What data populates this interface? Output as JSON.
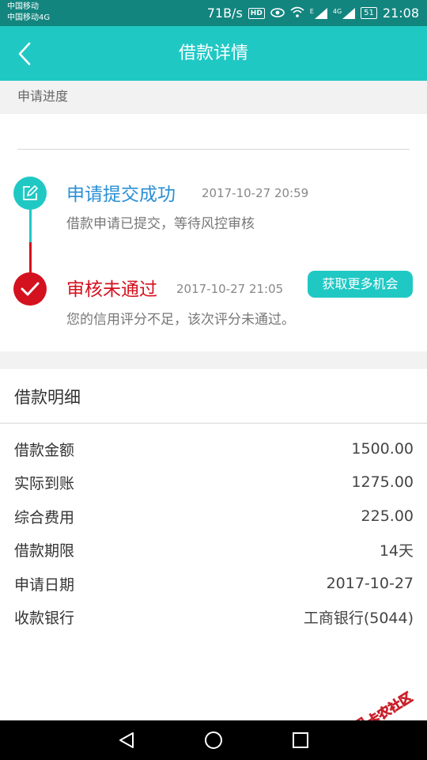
{
  "status_bar": {
    "carrier_1": "中国移动",
    "carrier_2": "中国移动4G",
    "speed": "71B/s",
    "hd": "HD",
    "signal_1_tag": "E",
    "signal_2_tag": "4G",
    "battery": "51",
    "time": "21:08"
  },
  "nav": {
    "title": "借款详情"
  },
  "progress": {
    "section_label": "申请进度",
    "steps": [
      {
        "title": "申请提交成功",
        "time": "2017-10-27 20:59",
        "desc": "借款申请已提交，等待风控审核"
      },
      {
        "title": "审核未通过",
        "time": "2017-10-27 21:05",
        "desc": "您的信用评分不足，该次评分未通过。",
        "action": "获取更多机会"
      }
    ]
  },
  "detail": {
    "title": "借款明细",
    "rows": [
      {
        "label": "借款金额",
        "value": "1500.00"
      },
      {
        "label": "实际到账",
        "value": "1275.00"
      },
      {
        "label": "综合费用",
        "value": "225.00"
      },
      {
        "label": "借款期限",
        "value": "14天"
      },
      {
        "label": "申请日期",
        "value": "2017-10-27"
      },
      {
        "label": "收款银行",
        "value": "工商银行(5044)"
      }
    ]
  },
  "watermark": {
    "text": "卡农社区"
  },
  "colors": {
    "status_bar": "#12857f",
    "accent": "#20c8c4",
    "success_text": "#2a8fd4",
    "fail": "#d4111e"
  },
  "icons": {
    "back": "chevron-left-icon",
    "step1": "edit-icon",
    "step2": "check-icon",
    "nav_back": "triangle-back-icon",
    "nav_home": "circle-home-icon",
    "nav_recent": "square-recent-icon"
  }
}
